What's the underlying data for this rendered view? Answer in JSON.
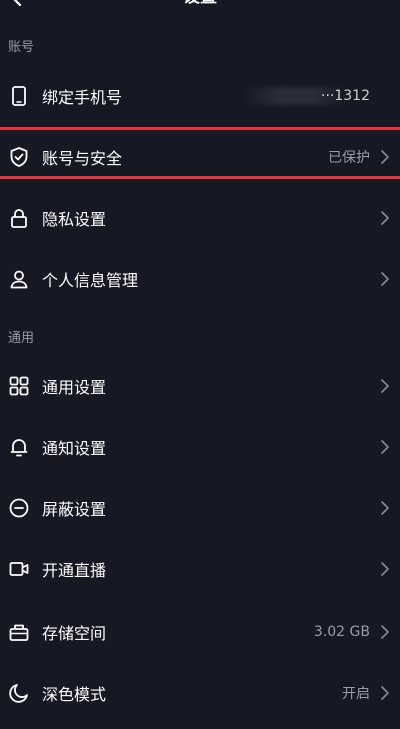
{
  "header": {
    "title": "设置",
    "back_icon": "chevron-left-icon"
  },
  "sections": {
    "account": "账号",
    "general": "通用"
  },
  "rows": {
    "bind_phone": {
      "label": "绑定手机号",
      "value": "···1312",
      "icon": "phone-icon"
    },
    "account_security": {
      "label": "账号与安全",
      "value": "已保护",
      "icon": "shield-check-icon"
    },
    "privacy": {
      "label": "隐私设置",
      "value": "",
      "icon": "lock-icon"
    },
    "personal_info": {
      "label": "个人信息管理",
      "value": "",
      "icon": "user-icon"
    },
    "general_settings": {
      "label": "通用设置",
      "value": "",
      "icon": "grid-icon"
    },
    "notifications": {
      "label": "通知设置",
      "value": "",
      "icon": "bell-icon"
    },
    "block": {
      "label": "屏蔽设置",
      "value": "",
      "icon": "minus-circle-icon"
    },
    "live": {
      "label": "开通直播",
      "value": "",
      "icon": "video-icon"
    },
    "storage": {
      "label": "存储空间",
      "value": "3.02 GB",
      "icon": "storage-icon"
    },
    "dark_mode": {
      "label": "深色模式",
      "value": "开启",
      "icon": "moon-icon"
    }
  },
  "colors": {
    "background": "#161823",
    "highlight": "#e8323c",
    "secondary_text": "#9a9ba3"
  }
}
